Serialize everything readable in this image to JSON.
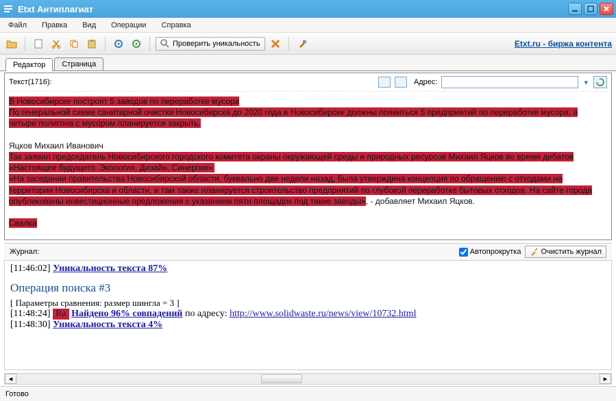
{
  "title": "Etxt Антиплагиат",
  "menu": {
    "file": "Файл",
    "edit": "Правка",
    "view": "Вид",
    "ops": "Операции",
    "help": "Справка"
  },
  "toolbar": {
    "check": "Проверить уникальность",
    "link": "Etxt.ru - биржа контента"
  },
  "tabs": {
    "editor": "Редактор",
    "page": "Страница"
  },
  "editor": {
    "text_count": "Текст(1716):",
    "addr_label": "Адрес:",
    "addr_value": "",
    "lines": {
      "l1": "В Новосибирске построят 5 заводов по переработке мусора",
      "l2": "По генеральной схеме санитарной очистки Новосибирска до 2020 года в Новосибирске должны появиться 5 предприятий по переработке мусора, а четыре полигона с мусором планируется закрыть.",
      "l3": "Яцков Михаил Иванович",
      "l4": "Так заявил председатель Новосибирского городского комитета охраны окружающей среды и природных ресурсов Михаил Яцков во время дебатов «Настоящее будущего. Экология. Дизайн. Синергия».",
      "l5a": "«На заседании правительства Новосибирской области, буквально две недели назад, была утверждена концепция по обращению с отходами на территории Новосибирска и области, и там также планируется строительство предприятий по глубокой переработке бытовых отходов. На сайте города опубликованы инвестиционные предложения с указанием пяти площадок под такие заводы»",
      "l5b": ", - добавляет Михаил Яцков.",
      "l6": "Свалка"
    }
  },
  "journal": {
    "label": "Журнал:",
    "autoscroll": "Автопрокрутка",
    "clear": "Очистить журнал",
    "entries": {
      "e1_ts": "[11:46:02]",
      "e1_text": "Уникальность текста 87%",
      "op_title": "Операция поиска #3",
      "params": "[ Параметры сравнения: размер шингла = 3 ]",
      "e2_ts": "[11:48:24]",
      "e2_badge": "Ra",
      "e2_link": "Найдено 96% совпадений",
      "e2_mid": " по адресу: ",
      "e2_url": "http://www.solidwaste.ru/news/view/10732.html",
      "e3_ts": "[11:48:30]",
      "e3_text": "Уникальность текста 4%"
    }
  },
  "status": "Готово"
}
